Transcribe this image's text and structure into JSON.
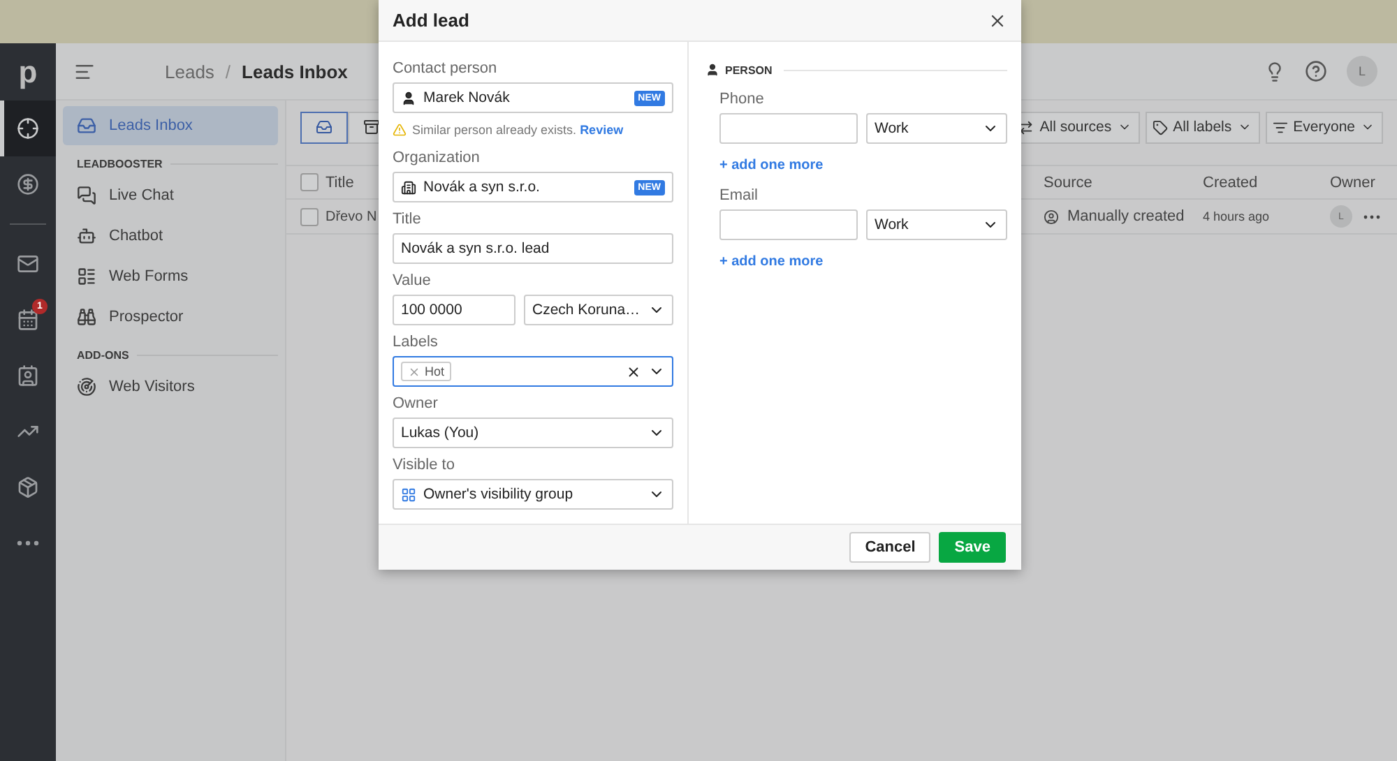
{
  "nav_rail": {
    "logo": "p",
    "groups": [
      [
        {
          "selected": true
        },
        {
          "selected": false
        }
      ],
      [
        {
          "selected": false
        },
        {
          "selected": false,
          "badge": "1"
        },
        {
          "selected": false
        },
        {
          "selected": false
        },
        {
          "selected": false
        },
        {
          "selected": false
        }
      ]
    ]
  },
  "breadcrumb": [
    "Leads",
    "Leads Inbox"
  ],
  "breadcrumb_separator": "/",
  "header": {
    "avatar": "L"
  },
  "sidebar": {
    "items": [
      {
        "label": "Leads Inbox",
        "selected": true
      }
    ],
    "sections": [
      {
        "title": "LEADBOOSTER",
        "items": [
          {
            "label": "Live Chat",
            "selected": false
          },
          {
            "label": "Chatbot",
            "selected": false
          },
          {
            "label": "Web Forms",
            "selected": false
          },
          {
            "label": "Prospector",
            "selected": false
          }
        ]
      },
      {
        "title": "ADD-ONS",
        "items": [
          {
            "label": "Web Visitors",
            "selected": false
          }
        ]
      }
    ]
  },
  "toolbar": {
    "views": [
      {
        "selected": true
      },
      {
        "selected": false
      }
    ],
    "filters": [
      {
        "label": "All sources"
      },
      {
        "label": "All labels"
      },
      {
        "label": "Everyone"
      }
    ]
  },
  "table": {
    "select_all_checked": false,
    "columns": [
      "Title",
      "Source",
      "Created",
      "Owner"
    ],
    "rows": [
      {
        "checked": false,
        "title": "Dřevo N",
        "source": "Manually created",
        "created": "4 hours ago",
        "owner": "L"
      }
    ]
  },
  "modal": {
    "title": "Add lead",
    "contact_person": {
      "label": "Contact person",
      "value": "Marek Novák",
      "badge": "NEW",
      "warning": "Similar person already exists.",
      "warning_link": "Review"
    },
    "organization": {
      "label": "Organization",
      "value": "Novák a syn s.r.o.",
      "badge": "NEW"
    },
    "title_field": {
      "label": "Title",
      "value": "Novák a syn s.r.o. lead"
    },
    "value_field": {
      "label": "Value",
      "amount": "100 0000",
      "currency": "Czech Koruna…"
    },
    "labels": {
      "label": "Labels",
      "focused": true,
      "tags": [
        "Hot"
      ]
    },
    "owner": {
      "label": "Owner",
      "value": "Lukas (You)"
    },
    "visible_to": {
      "label": "Visible to",
      "value": "Owner's visibility group"
    },
    "person": {
      "heading": "PERSON",
      "groups": [
        {
          "label": "Phone",
          "type": "Work",
          "add_more": "+ add one more"
        },
        {
          "label": "Email",
          "type": "Work",
          "add_more": "+ add one more"
        }
      ]
    },
    "buttons": {
      "cancel": "Cancel",
      "save": "Save"
    }
  }
}
